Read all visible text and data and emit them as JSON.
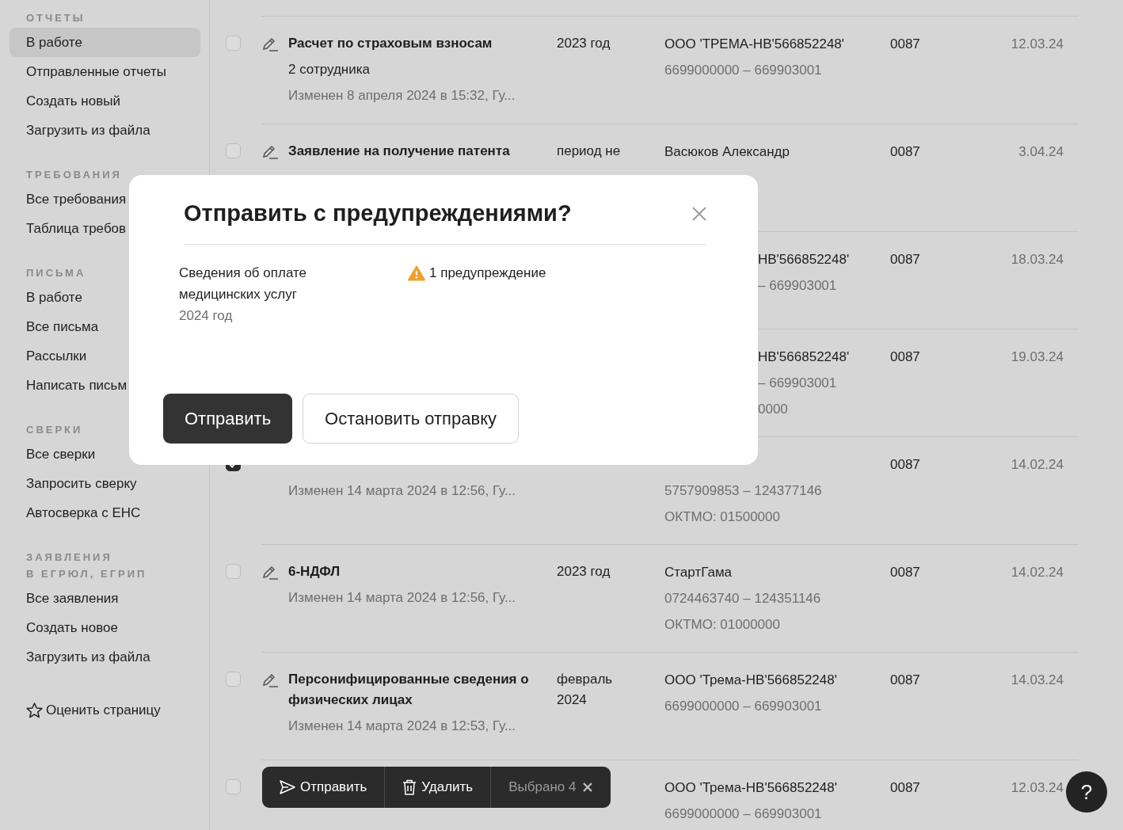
{
  "sidebar": {
    "sections": [
      {
        "title_lines": [
          "ОТЧЕТЫ"
        ],
        "items": [
          {
            "label": "В работе",
            "selected": true
          },
          {
            "label": "Отправленные отчеты",
            "selected": false
          },
          {
            "label": "Создать новый",
            "selected": false
          },
          {
            "label": "Загрузить из файла",
            "selected": false
          }
        ]
      },
      {
        "title_lines": [
          "ТРЕБОВАНИЯ"
        ],
        "items": [
          {
            "label": "Все требования",
            "selected": false
          },
          {
            "label": "Таблица требов",
            "selected": false
          }
        ]
      },
      {
        "title_lines": [
          "ПИСЬМА"
        ],
        "items": [
          {
            "label": "В работе",
            "selected": false
          },
          {
            "label": "Все письма",
            "selected": false
          },
          {
            "label": "Рассылки",
            "selected": false
          },
          {
            "label": "Написать письм",
            "selected": false
          }
        ]
      },
      {
        "title_lines": [
          "СВЕРКИ"
        ],
        "items": [
          {
            "label": "Все сверки",
            "selected": false
          },
          {
            "label": "Запросить сверку",
            "selected": false
          },
          {
            "label": "Автосверка с ЕНС",
            "selected": false
          }
        ]
      },
      {
        "title_lines": [
          "ЗАЯВЛЕНИЯ",
          "В ЕГРЮЛ, ЕГРИП"
        ],
        "items": [
          {
            "label": "Все заявления",
            "selected": false
          },
          {
            "label": "Создать новое",
            "selected": false
          },
          {
            "label": "Загрузить из файла",
            "selected": false
          }
        ]
      }
    ],
    "rate_link": "Оценить страницу"
  },
  "rows": [
    {
      "kind": "full",
      "checked": false,
      "title": "Расчет по страховым взносам",
      "subtitle": "2 сотрудника",
      "modified": "Изменен 8 апреля 2024 в 15:32, Гу...",
      "period": "2023 год",
      "org": "ООО 'ТРЕМА-НВ'566852248'",
      "inn": "6699000000 – 669903001",
      "code": "0087",
      "date": "12.03.24"
    },
    {
      "kind": "full",
      "checked": false,
      "title": "Заявление на получение патента",
      "period": "период не",
      "org": "Васюков Александр",
      "code": "0087",
      "date": "3.04.24"
    },
    {
      "kind": "right_part",
      "org": "НВ'566852248'",
      "inn": "– 669903001",
      "code": "0087",
      "date": "18.03.24"
    },
    {
      "kind": "right_part",
      "org": "НВ'566852248'",
      "inn": "– 669903001",
      "oktmo": "0000",
      "code": "0087",
      "date": "19.03.24"
    },
    {
      "kind": "full",
      "checked": true,
      "modified": "Изменен 14 марта 2024 в 12:56, Гу...",
      "inn": "5757909853 – 124377146",
      "oktmo": "ОКТМО: 01500000",
      "code": "0087",
      "date": "14.02.24"
    },
    {
      "kind": "full",
      "checked": false,
      "title": "6-НДФЛ",
      "modified": "Изменен 14 марта 2024 в 12:56, Гу...",
      "period": "2023 год",
      "org": "СтартГама",
      "inn": "0724463740 – 124351146",
      "oktmo": "ОКТМО: 01000000",
      "code": "0087",
      "date": "14.02.24"
    },
    {
      "kind": "full",
      "checked": false,
      "title": "Персонифицированные сведения о физических лицах",
      "modified": "Изменен 14 марта 2024 в 12:53, Гу...",
      "period": "февраль 2024",
      "org": "ООО 'Трема-НВ'566852248'",
      "inn": "6699000000 – 669903001",
      "code": "0087",
      "date": "14.03.24"
    },
    {
      "kind": "full",
      "checked": false,
      "org": "ООО 'Трема-НВ'566852248'",
      "inn": "6699000000 – 669903001",
      "code": "0087",
      "date": "12.03.24"
    }
  ],
  "dialog": {
    "title": "Отправить с предупреждениями?",
    "items": [
      {
        "name": "Сведения об оплате медицинских услуг",
        "period": "2024 год",
        "warning": "1 предупреждение"
      }
    ],
    "buttons": [
      {
        "label": "Отправить",
        "kind": "primary"
      },
      {
        "label": "Остановить отправку",
        "kind": "secondary"
      }
    ]
  },
  "toolbar": {
    "actions": [
      {
        "label": "Отправить",
        "kind": "send"
      },
      {
        "label": "Удалить",
        "kind": "delete"
      }
    ],
    "selected_label": "Выбрано 4"
  },
  "help": "?"
}
